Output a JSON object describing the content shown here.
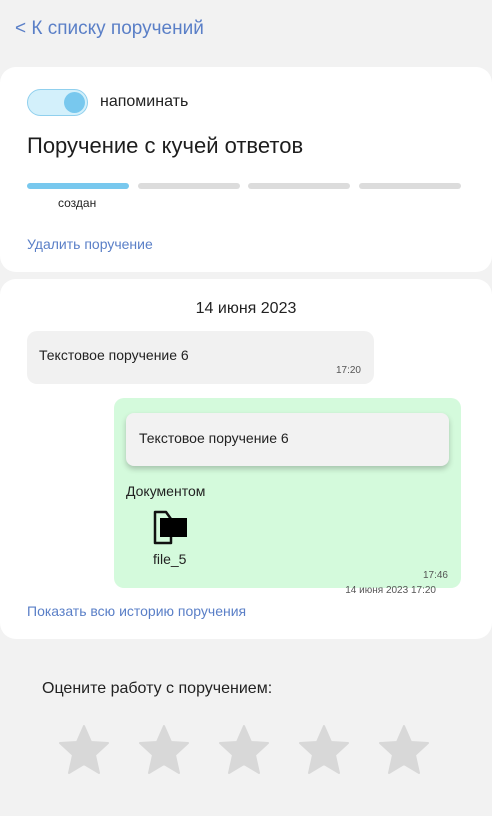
{
  "nav": {
    "back_label": "< К списку поручений"
  },
  "task": {
    "remind_label": "напоминать",
    "remind_on": true,
    "title": "Поручение с кучей ответов",
    "progress_steps": 4,
    "progress_current": 1,
    "status_label": "создан",
    "delete_label": "Удалить поручение"
  },
  "chat": {
    "date": "14 июня 2023",
    "messages": [
      {
        "text": "Текстовое поручение 6",
        "time": "17:20"
      },
      {
        "quote_text": "Текстовое поручение 6",
        "quote_time": "14 июня 2023 17:20",
        "label": "Документом",
        "file_icon": "document-icon",
        "file_name": "file_5",
        "time": "17:46"
      }
    ],
    "history_label": "Показать всю историю поручения"
  },
  "rating": {
    "label": "Оцените работу с поручением:",
    "max": 5,
    "value": 0,
    "icon": "star-icon"
  },
  "colors": {
    "accent": "#78c8ee",
    "link": "#5a7fc7",
    "outgoing_bubble": "#d4fadc",
    "incoming_bubble": "#f1f1f1",
    "star_inactive": "#d8d8d8"
  }
}
